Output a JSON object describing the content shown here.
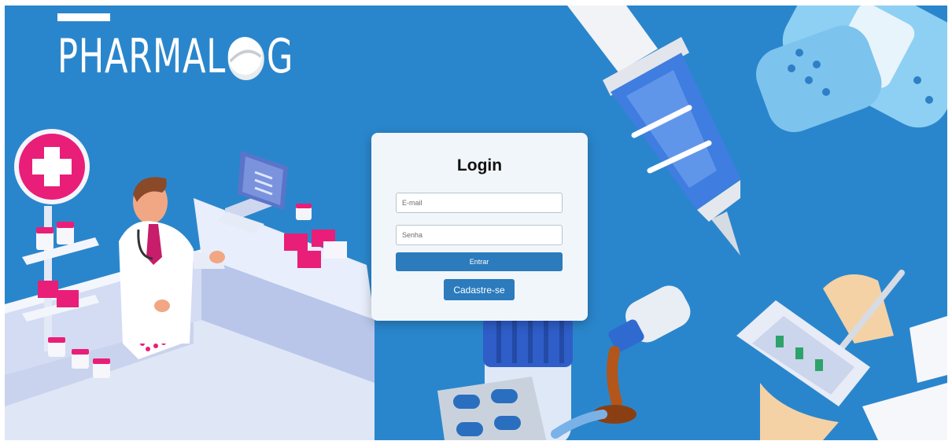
{
  "brand": {
    "logo_prefix": "PHARMAL",
    "logo_suffix": "G"
  },
  "login": {
    "title": "Login",
    "email_placeholder": "E-mail",
    "password_placeholder": "Senha",
    "submit_label": "Entrar",
    "register_label": "Cadastre-se"
  },
  "colors": {
    "background": "#2a86cc",
    "card": "#f1f6fb",
    "button": "#2b7bbd"
  }
}
